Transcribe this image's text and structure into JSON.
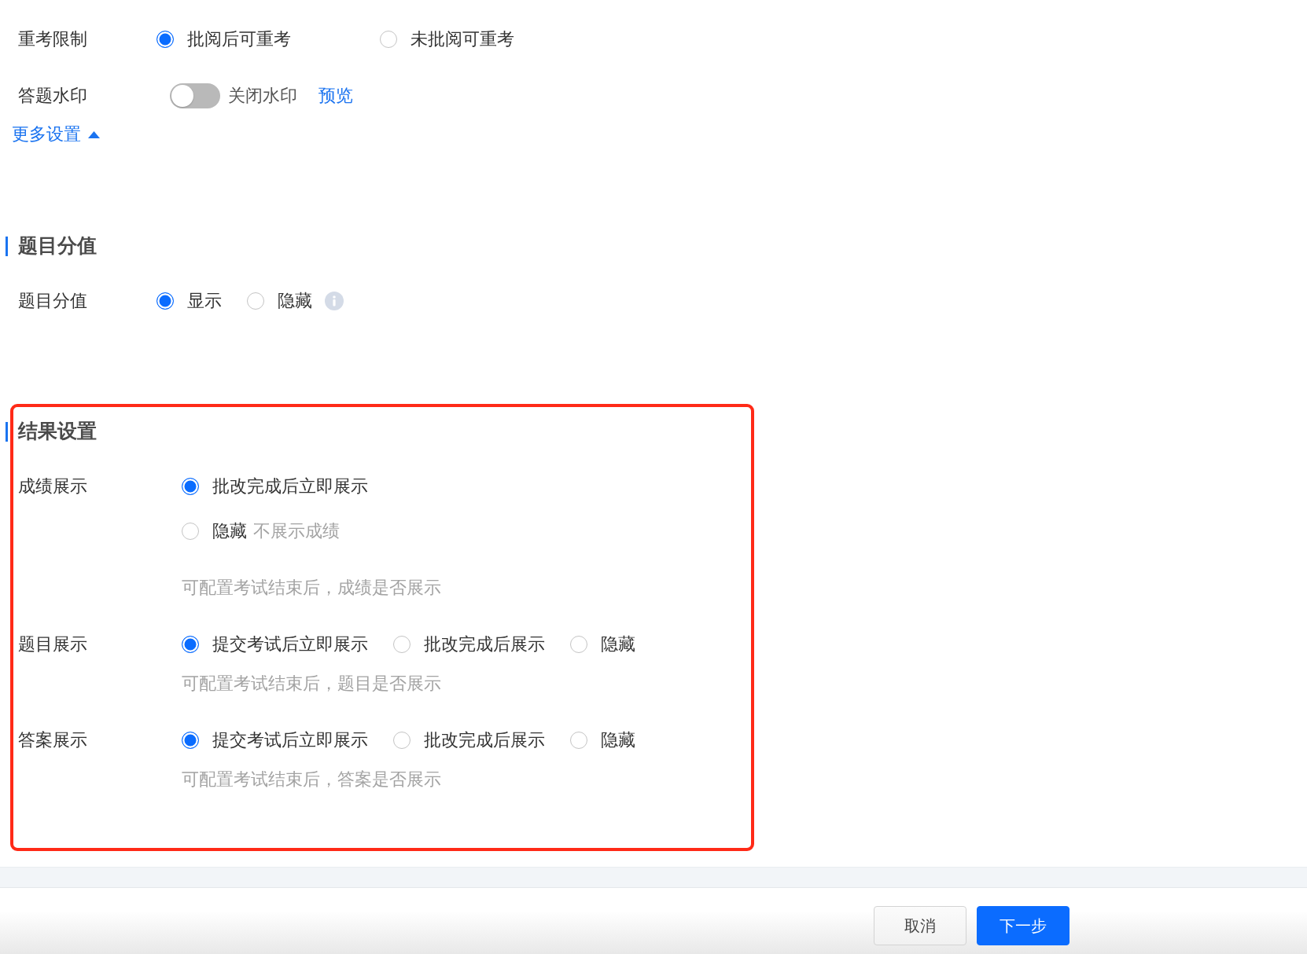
{
  "settings": [
    {
      "label": "重考限制",
      "kind": "radio",
      "options": [
        {
          "label": "批阅后可重考",
          "selected": true
        },
        {
          "label": "未批阅可重考",
          "selected": false
        }
      ]
    },
    {
      "label": "答题水印",
      "kind": "toggle",
      "on": false,
      "state_text": "关闭水印",
      "link": "预览"
    }
  ],
  "more_settings": {
    "label": "更多设置",
    "expanded": true
  },
  "sections": [
    {
      "title": "题目分值",
      "rows": [
        {
          "label": "题目分值",
          "kind": "radio",
          "info": true,
          "options": [
            {
              "label": "显示",
              "selected": true
            },
            {
              "label": "隐藏",
              "selected": false
            }
          ]
        }
      ]
    },
    {
      "title": "结果设置",
      "highlighted": true,
      "rows": [
        {
          "label": "成绩展示",
          "kind": "radio-list",
          "options": [
            {
              "label": "批改完成后立即展示",
              "selected": true
            },
            {
              "label": "隐藏",
              "note": "不展示成绩",
              "selected": false
            }
          ],
          "hint": "可配置考试结束后，成绩是否展示"
        },
        {
          "label": "题目展示",
          "kind": "radio",
          "options": [
            {
              "label": "提交考试后立即展示",
              "selected": true
            },
            {
              "label": "批改完成后展示",
              "selected": false
            },
            {
              "label": "隐藏",
              "selected": false
            }
          ],
          "hint": "可配置考试结束后，题目是否展示"
        },
        {
          "label": "答案展示",
          "kind": "radio",
          "options": [
            {
              "label": "提交考试后立即展示",
              "selected": true
            },
            {
              "label": "批改完成后展示",
              "selected": false
            },
            {
              "label": "隐藏",
              "selected": false
            }
          ],
          "hint": "可配置考试结束后，答案是否展示"
        }
      ]
    }
  ],
  "footer": {
    "buttons": [
      {
        "label": "取消",
        "kind": "secondary"
      },
      {
        "label": "下一步",
        "kind": "primary"
      }
    ]
  }
}
